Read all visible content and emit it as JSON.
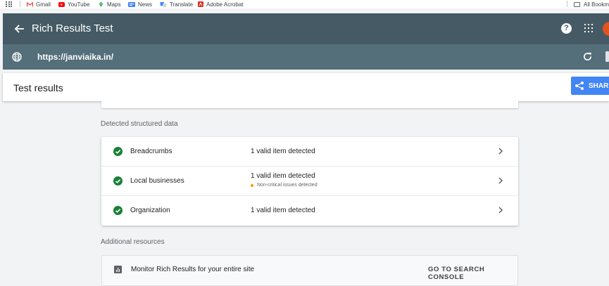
{
  "bookmarks": {
    "items": [
      {
        "label": "Gmail",
        "icon": "gmail-icon",
        "color": "#ea4335"
      },
      {
        "label": "YouTube",
        "icon": "youtube-icon",
        "color": "#ff0000"
      },
      {
        "label": "Maps",
        "icon": "maps-icon",
        "color": "#34a853"
      },
      {
        "label": "News",
        "icon": "news-icon",
        "color": "#4285f4"
      },
      {
        "label": "Translate",
        "icon": "translate-icon",
        "color": "#4285f4"
      },
      {
        "label": "Adobe Acrobat",
        "icon": "acrobat-icon",
        "color": "#d93025"
      }
    ],
    "all_bookmarks": "All Bookm"
  },
  "app": {
    "title": "Rich Results Test",
    "url": "https://janviaika.in/"
  },
  "results": {
    "title": "Test results",
    "share_label": "SHARE"
  },
  "detected": {
    "label": "Detected structured data",
    "rows": [
      {
        "name": "Breadcrumbs",
        "status": "1 valid item detected",
        "note": ""
      },
      {
        "name": "Local businesses",
        "status": "1 valid item detected",
        "note": "Non-critical issues detected"
      },
      {
        "name": "Organization",
        "status": "1 valid item detected",
        "note": ""
      }
    ]
  },
  "resources": {
    "label": "Additional resources",
    "monitor_text": "Monitor Rich Results for your entire site",
    "console_link": "GO TO SEARCH CONSOLE"
  },
  "colors": {
    "appbar": "#455a64",
    "urlbar": "#546e7a",
    "accent": "#4285f4",
    "success": "#188038",
    "warning": "#f29900"
  }
}
